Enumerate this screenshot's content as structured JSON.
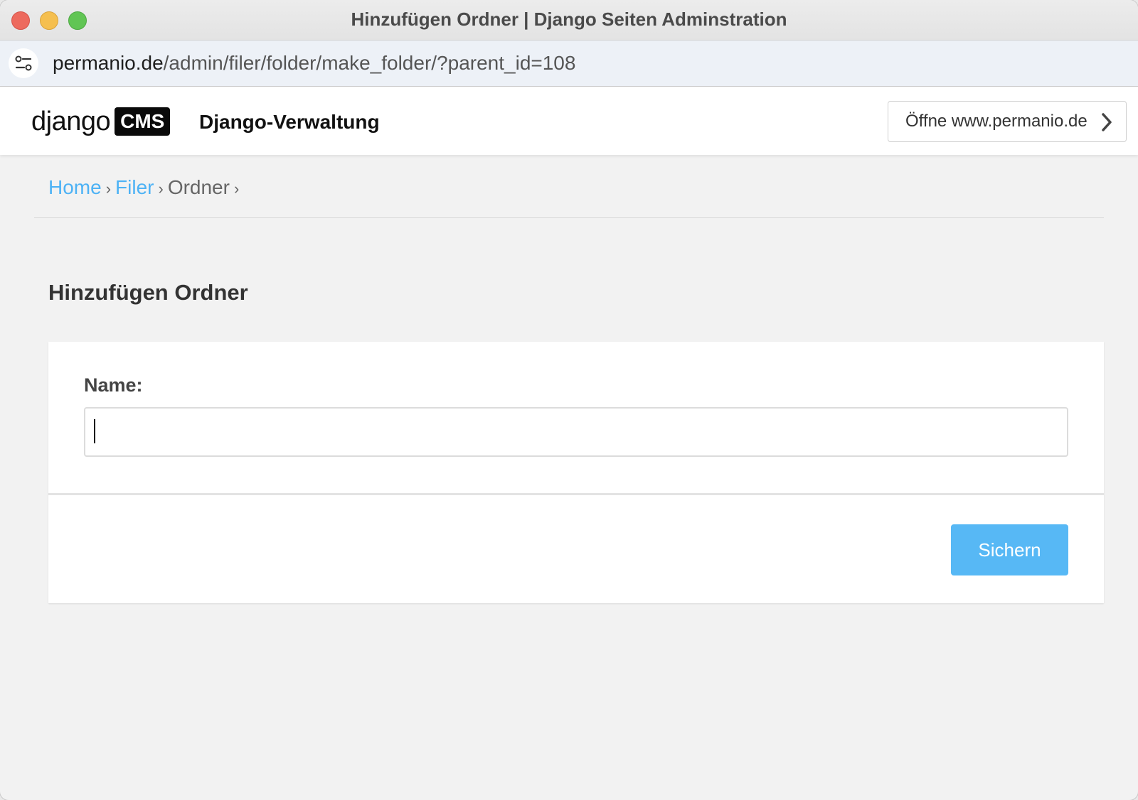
{
  "window": {
    "title": "Hinzufügen Ordner | Django Seiten Adminstration"
  },
  "urlbar": {
    "domain": "permanio.de",
    "path": "/admin/filer/folder/make_folder/?parent_id=108",
    "site_icon": "site-settings-icon"
  },
  "header": {
    "logo_text": "django",
    "logo_badge": "CMS",
    "site_name": "Django-Verwaltung",
    "open_site_label": "Öffne www.permanio.de",
    "open_site_icon": "chevron-right-icon"
  },
  "breadcrumbs": {
    "items": [
      "Home",
      "Filer",
      "Ordner"
    ],
    "separator": "›"
  },
  "page": {
    "title": "Hinzufügen Ordner"
  },
  "form": {
    "name_label": "Name:",
    "name_value": "",
    "save_label": "Sichern"
  },
  "colors": {
    "link": "#4db2f5",
    "primary_button": "#57b8f5",
    "background": "#f2f2f2"
  }
}
